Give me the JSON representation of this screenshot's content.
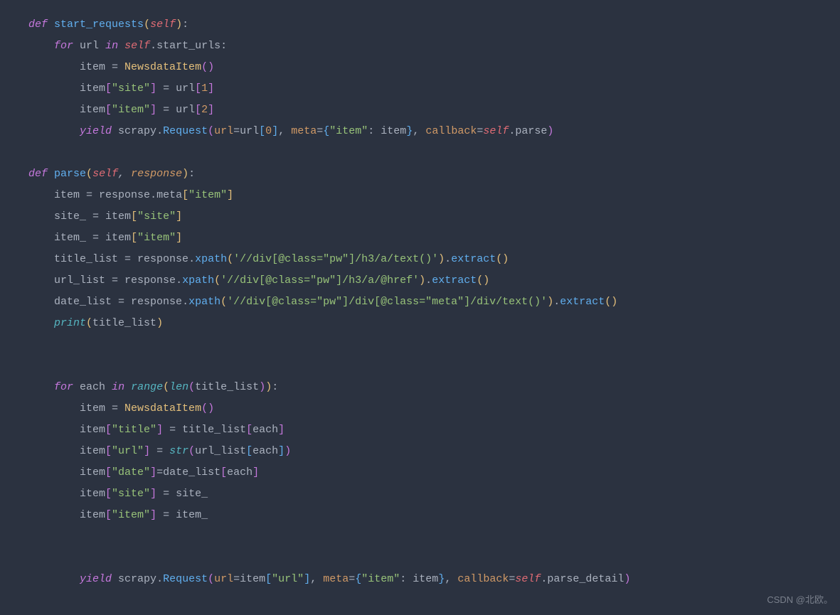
{
  "watermark": "CSDN @北欧。",
  "code": {
    "def": "def",
    "for": "for",
    "in": "in",
    "yield": "yield",
    "self": "self",
    "start_requests": "start_requests",
    "parse": "parse",
    "parse_detail": "parse_detail",
    "NewsdataItem": "NewsdataItem",
    "Request": "Request",
    "response": "response",
    "url_var": "url",
    "start_urls": "start_urls",
    "item": "item",
    "site": "\"site\"",
    "item_key": "\"item\"",
    "title_key": "\"title\"",
    "url_key": "\"url\"",
    "date_key": "\"date\"",
    "num0": "0",
    "num1": "1",
    "num2": "2",
    "scrapy": "scrapy",
    "url_kw": "url",
    "meta_kw": "meta",
    "callback_kw": "callback",
    "meta_attr": "meta",
    "site_": "site_",
    "item_": "item_",
    "title_list": "title_list",
    "url_list": "url_list",
    "date_list": "date_list",
    "xpath": "xpath",
    "extract": "extract",
    "xpath1": "'//div[@class=\"pw\"]/h3/a/text()'",
    "xpath2": "'//div[@class=\"pw\"]/h3/a/@href'",
    "xpath3": "'//div[@class=\"pw\"]/div[@class=\"meta\"]/div/text()'",
    "print": "print",
    "each": "each",
    "range": "range",
    "len": "len",
    "str": "str"
  }
}
